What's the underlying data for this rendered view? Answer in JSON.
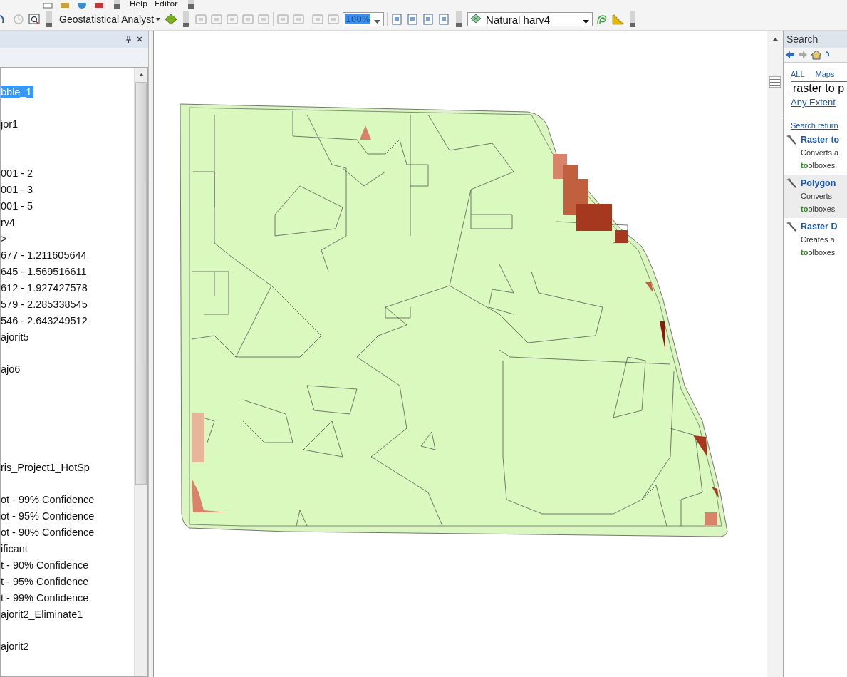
{
  "menu_bar": {
    "items": [
      "Help",
      "Editor"
    ]
  },
  "toolbar": {
    "analyst_menu": "Geostatistical Analyst",
    "zoom_combo": "100%",
    "layer_combo": "Natural harv4"
  },
  "toc": {
    "items": [
      {
        "label": "bble_1",
        "kind": "layer",
        "selected": true
      },
      {
        "label": "jor1",
        "kind": "layer",
        "selected": false
      },
      {
        "label": "001 - 2",
        "kind": "group",
        "selected": false
      },
      {
        "label": "001 - 3",
        "kind": "class",
        "selected": false
      },
      {
        "label": "001 - 5",
        "kind": "class",
        "selected": false
      },
      {
        "label": "rv4",
        "kind": "class",
        "selected": false
      },
      {
        "label": ">",
        "kind": "class",
        "selected": false
      },
      {
        "label": "677 - 1.211605644",
        "kind": "class",
        "selected": false
      },
      {
        "label": "645 - 1.569516611",
        "kind": "class",
        "selected": false
      },
      {
        "label": "612 - 1.927427578",
        "kind": "class",
        "selected": false
      },
      {
        "label": "579 - 2.285338545",
        "kind": "class",
        "selected": false
      },
      {
        "label": "546 - 2.643249512",
        "kind": "class",
        "selected": false
      },
      {
        "label": "ajorit5",
        "kind": "class",
        "selected": false
      },
      {
        "label": "ajo6",
        "kind": "layer",
        "selected": false
      },
      {
        "label": "ris_Project1_HotSp",
        "kind": "section",
        "selected": false
      },
      {
        "label": "ot - 99% Confidence",
        "kind": "layer",
        "selected": false
      },
      {
        "label": "ot - 95% Confidence",
        "kind": "class",
        "selected": false
      },
      {
        "label": "ot - 90% Confidence",
        "kind": "class",
        "selected": false
      },
      {
        "label": "ificant",
        "kind": "class",
        "selected": false
      },
      {
        "label": "t - 90% Confidence",
        "kind": "class",
        "selected": false
      },
      {
        "label": "t - 95% Confidence",
        "kind": "class",
        "selected": false
      },
      {
        "label": "t - 99% Confidence",
        "kind": "class",
        "selected": false
      },
      {
        "label": "ajorit2_Eliminate1",
        "kind": "class",
        "selected": false
      },
      {
        "label": "ajorit2",
        "kind": "layer",
        "selected": false
      }
    ]
  },
  "search": {
    "title": "Search",
    "tabs": [
      "ALL",
      "Maps"
    ],
    "query": "raster to p",
    "extent": "Any Extent",
    "summary": "Search return",
    "results": [
      {
        "title": "Raster to",
        "description": "Converts a",
        "path": "**to**olboxes",
        "selected": false
      },
      {
        "title": "Polygon",
        "description": "Converts",
        "path": "**to**olboxes",
        "selected": true
      },
      {
        "title": "**Raster** D",
        "description": "Creates a",
        "path": "**to**olboxes",
        "selected": false
      }
    ]
  }
}
